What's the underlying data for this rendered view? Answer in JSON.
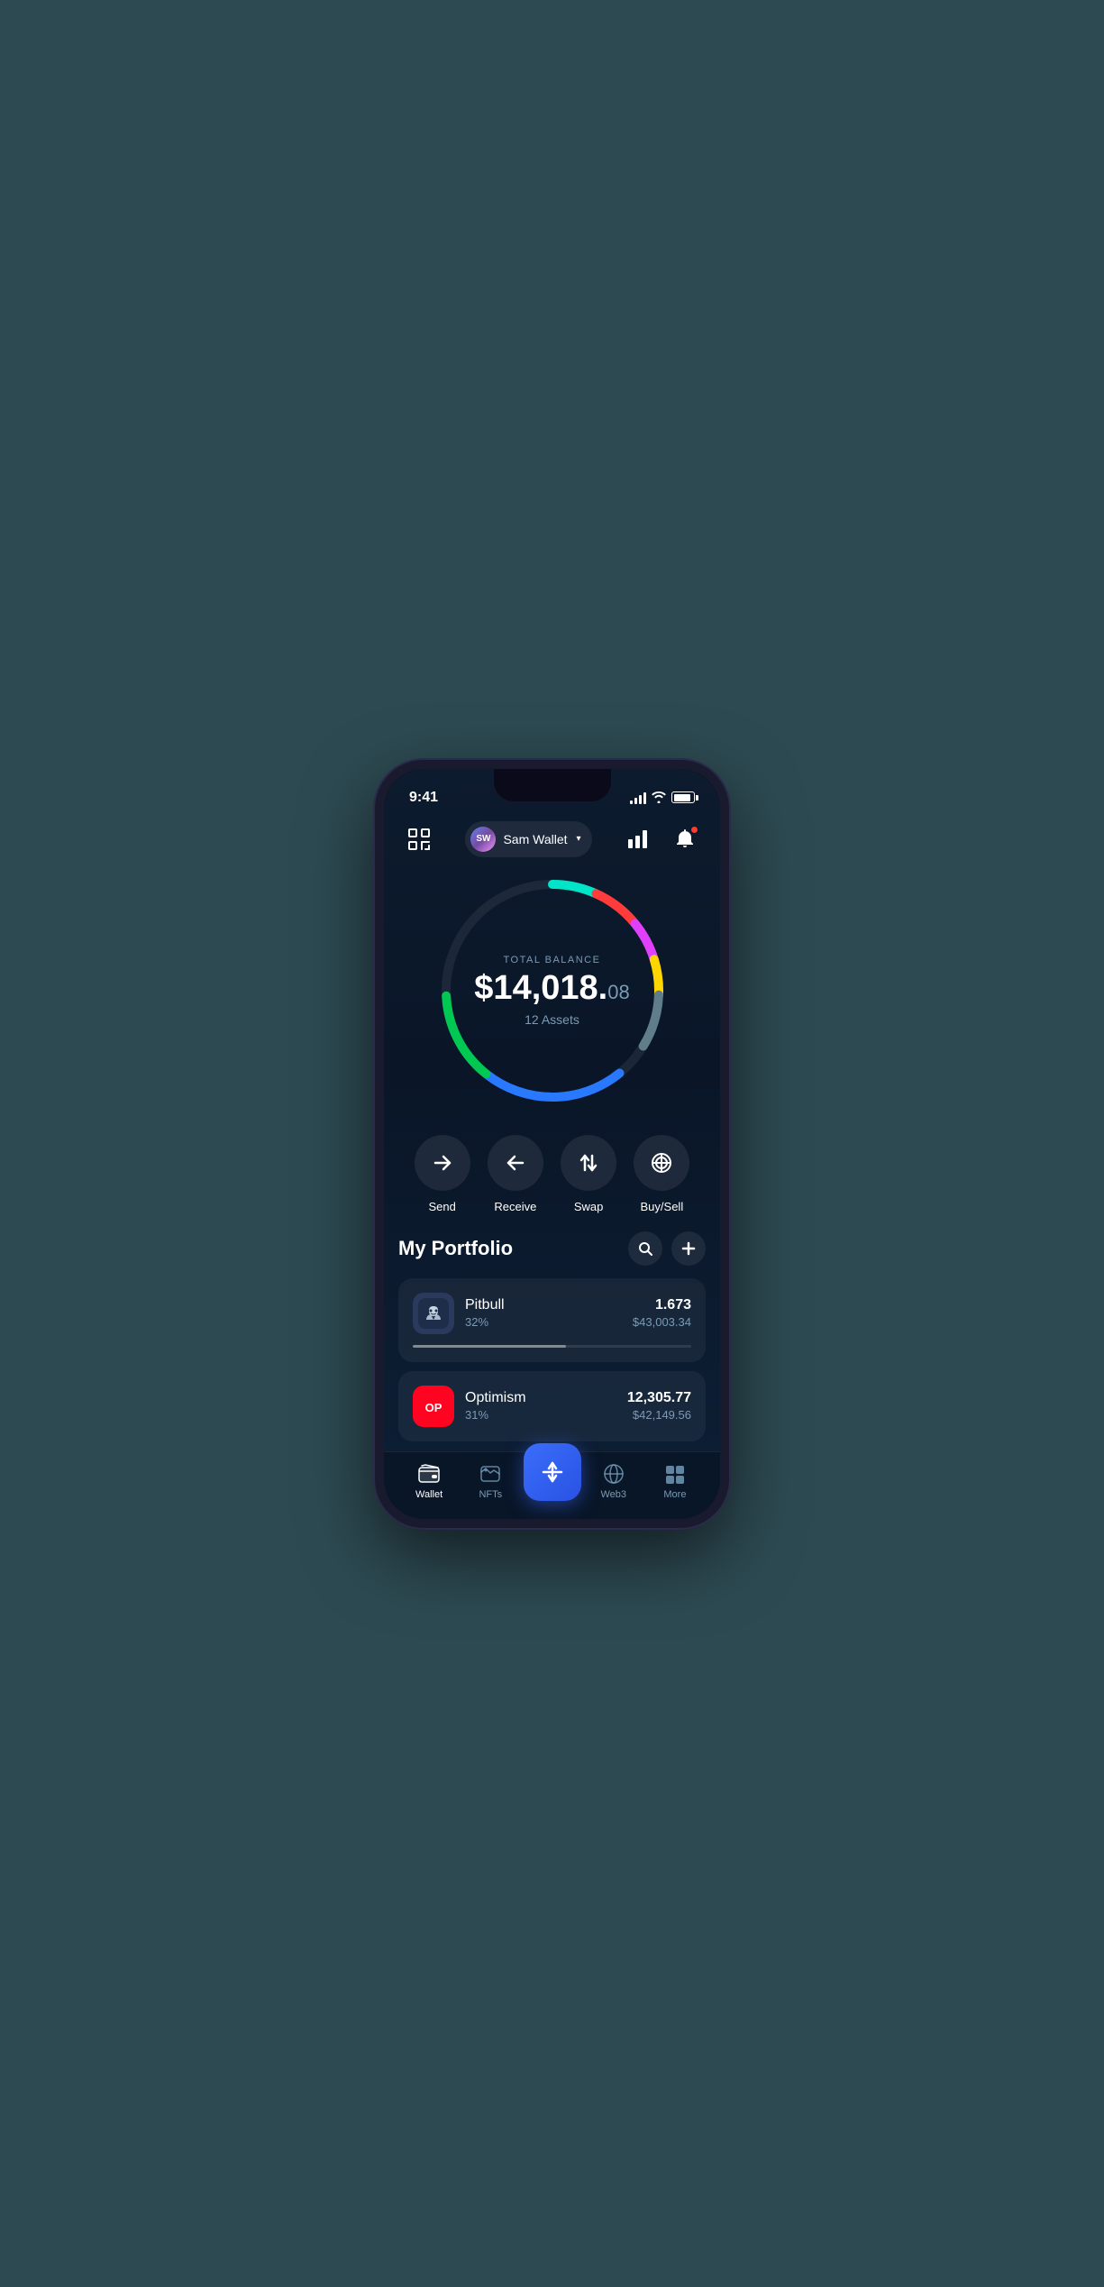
{
  "statusBar": {
    "time": "9:41"
  },
  "header": {
    "avatarInitials": "SW",
    "userName": "Sam Wallet",
    "scanIconLabel": "scan-icon",
    "chartIconLabel": "chart-icon",
    "bellIconLabel": "bell-icon"
  },
  "balance": {
    "label": "TOTAL BALANCE",
    "mainAmount": "$14,018.",
    "cents": "08",
    "assets": "12 Assets"
  },
  "actions": [
    {
      "id": "send",
      "label": "Send"
    },
    {
      "id": "receive",
      "label": "Receive"
    },
    {
      "id": "swap",
      "label": "Swap"
    },
    {
      "id": "buysell",
      "label": "Buy/Sell"
    }
  ],
  "portfolio": {
    "title": "My Portfolio",
    "items": [
      {
        "name": "Pitbull",
        "percent": "32%",
        "amount": "1.673",
        "usd": "$43,003.34",
        "progressWidth": "55"
      },
      {
        "name": "Optimism",
        "percent": "31%",
        "amount": "12,305.77",
        "usd": "$42,149.56",
        "progressWidth": "50"
      }
    ]
  },
  "nav": {
    "items": [
      {
        "id": "wallet",
        "label": "Wallet",
        "active": true
      },
      {
        "id": "nfts",
        "label": "NFTs",
        "active": false
      },
      {
        "id": "center",
        "label": "",
        "active": false
      },
      {
        "id": "web3",
        "label": "Web3",
        "active": false
      },
      {
        "id": "more",
        "label": "More",
        "active": false
      }
    ]
  },
  "colors": {
    "accent": "#3b6dfa",
    "background": "#0a1628",
    "cardBg": "rgba(255,255,255,0.05)",
    "textMuted": "#7a9bb5"
  }
}
